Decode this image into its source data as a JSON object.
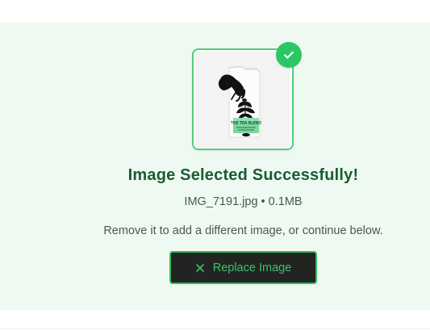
{
  "upload": {
    "title": "Image Selected Successfully!",
    "file_name": "IMG_7191.jpg",
    "separator": "•",
    "file_size": "0.1MB",
    "helper": "Remove it to add a different image, or continue below.",
    "replace_label": "Replace Image",
    "product_label": "THE TEA BLEND"
  },
  "colors": {
    "accent": "#2cc764",
    "panel_bg": "#eefaf1",
    "title": "#1c5b34",
    "button_bg": "#222422",
    "button_text": "#3fc06b"
  },
  "icons": {
    "badge": "check-icon",
    "button": "close-icon"
  }
}
